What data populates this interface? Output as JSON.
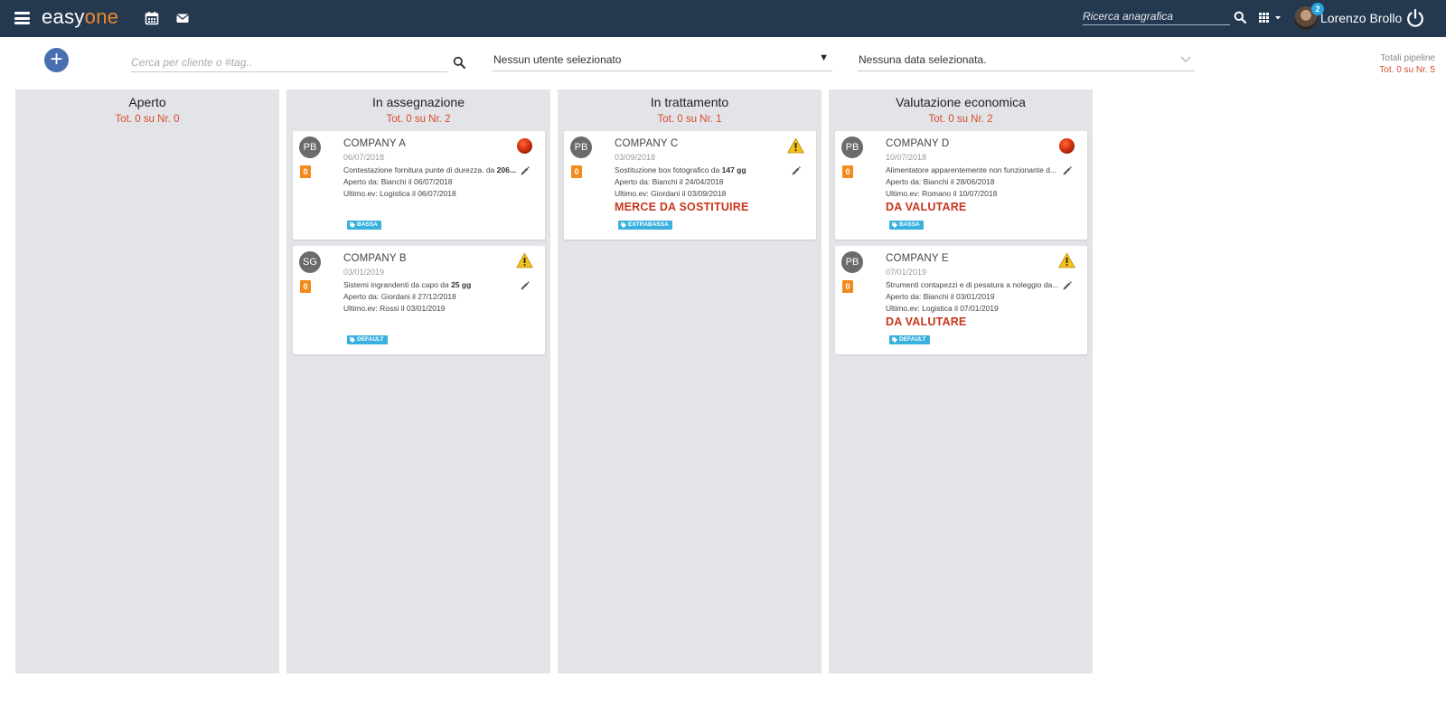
{
  "app": {
    "logo_easy": "easy",
    "logo_one": "one",
    "search_placeholder": "Ricerca anagrafica",
    "notification_count": "2",
    "user_name": "Lorenzo Brollo"
  },
  "toolbar": {
    "add_label": "+",
    "client_search_placeholder": "Cerca per cliente o #tag..",
    "user_select_value": "Nessun utente selezionato",
    "date_select_value": "Nessuna data selezionata.",
    "totals_label": "Totali pipeline",
    "totals_value": "Tot. 0 su Nr. 5"
  },
  "colors": {
    "topbar": "#243850",
    "accent_orange": "#f08a2a",
    "status_red": "#c9371f",
    "tag_blue": "#3ab0df",
    "column_bg": "#e2e4e7"
  },
  "columns": [
    {
      "title": "Aperto",
      "subtitle": "Tot. 0 su Nr. 0",
      "cards": []
    },
    {
      "title": "In assegnazione",
      "subtitle": "Tot. 0 su Nr. 2",
      "cards": [
        {
          "initials": "PB",
          "counter": "0",
          "company": "COMPANY A",
          "date": "06/07/2018",
          "desc_prefix": "Contestazione fornitura punte di durezza. da ",
          "desc_bold": "206...",
          "opened": "Aperto da: Bianchi il 06/07/2018",
          "last_event": "Ultimo.ev: Logistica il 06/07/2018",
          "status": "",
          "tag": "BASSA",
          "priority_icon": "red-circle-icon"
        },
        {
          "initials": "SG",
          "counter": "0",
          "company": "COMPANY B",
          "date": "03/01/2019",
          "desc_prefix": "Sistemi ingrandenti da capo da ",
          "desc_bold": "25 gg",
          "opened": "Aperto da: Giordani il 27/12/2018",
          "last_event": "Ultimo.ev: Rossi il 03/01/2019",
          "status": "",
          "tag": "DEFAULT",
          "priority_icon": "warning-icon"
        }
      ]
    },
    {
      "title": "In trattamento",
      "subtitle": "Tot. 0 su Nr. 1",
      "cards": [
        {
          "initials": "PB",
          "counter": "0",
          "company": "COMPANY C",
          "date": "03/09/2018",
          "desc_prefix": "Sostituzione box fotografico da ",
          "desc_bold": "147 gg",
          "opened": "Aperto da: Bianchi il 24/04/2018",
          "last_event": "Ultimo.ev: Giordani il 03/09/2018",
          "status": "MERCE DA SOSTITUIRE",
          "tag": "EXTRABASSA",
          "priority_icon": "warning-icon"
        }
      ]
    },
    {
      "title": "Valutazione economica",
      "subtitle": "Tot. 0 su Nr. 2",
      "cards": [
        {
          "initials": "PB",
          "counter": "0",
          "company": "COMPANY D",
          "date": "10/07/2018",
          "desc_prefix": "Alimentatore apparentemente non funzionante d...",
          "desc_bold": "",
          "opened": "Aperto da: Bianchi il 28/06/2018",
          "last_event": "Ultimo.ev: Romano il 10/07/2018",
          "status": "DA VALUTARE",
          "tag": "BASSA",
          "priority_icon": "red-circle-icon"
        },
        {
          "initials": "PB",
          "counter": "0",
          "company": "COMPANY E",
          "date": "07/01/2019",
          "desc_prefix": "Strumenti contapezzi e di pesatura a noleggio da...",
          "desc_bold": "",
          "opened": "Aperto da: Bianchi il 03/01/2019",
          "last_event": "Ultimo.ev: Logistica il 07/01/2019",
          "status": "DA VALUTARE",
          "tag": "DEFAULT",
          "priority_icon": "warning-icon"
        }
      ]
    }
  ]
}
